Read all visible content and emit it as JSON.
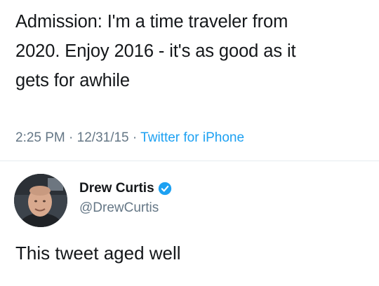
{
  "quoted_tweet": {
    "text_line1": "Admission: I'm a time traveler from",
    "text_line2": "2020. Enjoy 2016 - it's as good as it",
    "text_line3": "gets for awhile",
    "time": "2:25 PM",
    "separator": " · ",
    "date": "12/31/15",
    "source": "Twitter for iPhone"
  },
  "reply": {
    "author_name": "Drew Curtis",
    "handle": "@DrewCurtis",
    "verified_icon": "verified-badge-icon",
    "text": "This tweet aged well"
  },
  "colors": {
    "text": "#14171a",
    "muted": "#657786",
    "link": "#1da1f2",
    "verified": "#1da1f2"
  }
}
